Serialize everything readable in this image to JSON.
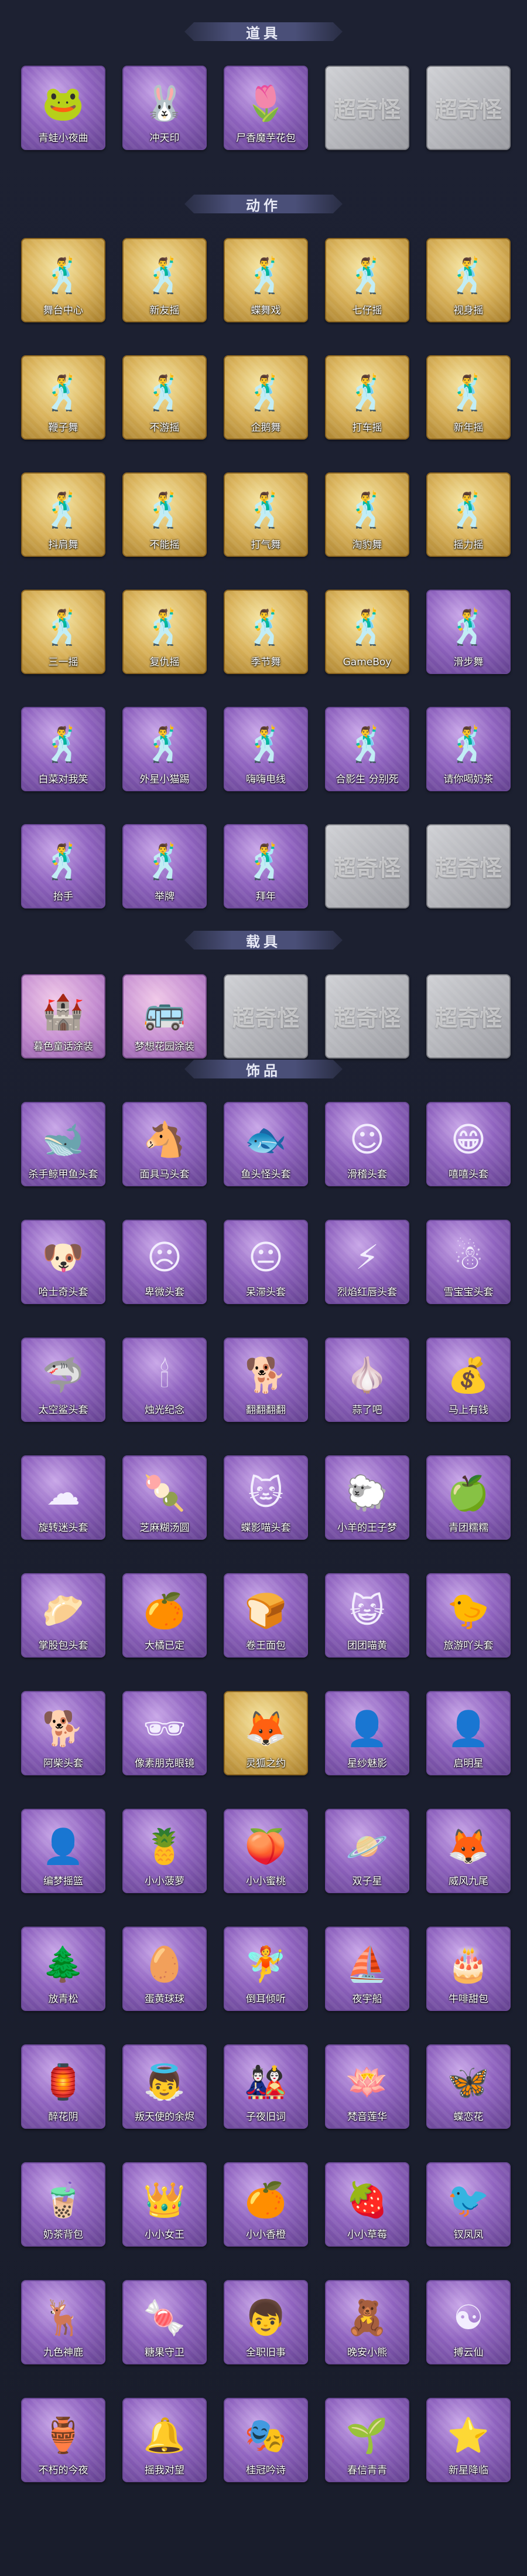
{
  "sections": [
    {
      "title": "道具",
      "items": [
        {
          "label": "青蛙小夜曲",
          "icon": "frog-icon",
          "style": "purple"
        },
        {
          "label": "冲天印",
          "icon": "bunny-mug-icon",
          "style": "purple"
        },
        {
          "label": "尸香魔芋花包",
          "icon": "flower-bag-icon",
          "style": "purple"
        },
        {
          "label": "",
          "icon": "mystery-icon",
          "style": "grey",
          "placeholder_text": "超奇怪"
        },
        {
          "label": "",
          "icon": "mystery-icon",
          "style": "grey",
          "placeholder_text": "超奇怪"
        }
      ]
    },
    {
      "title": "动作",
      "items": [
        {
          "label": "舞台中心",
          "icon": "pose-icon",
          "style": "gold"
        },
        {
          "label": "新友摇",
          "icon": "pose-icon",
          "style": "gold"
        },
        {
          "label": "蝶舞戏",
          "icon": "pose-icon",
          "style": "gold"
        },
        {
          "label": "七仔摇",
          "icon": "pose-icon",
          "style": "gold"
        },
        {
          "label": "视身摇",
          "icon": "pose-icon",
          "style": "gold"
        },
        {
          "label": "鞭子舞",
          "icon": "pose-icon",
          "style": "gold"
        },
        {
          "label": "不游摇",
          "icon": "pose-icon",
          "style": "gold"
        },
        {
          "label": "企鹅舞",
          "icon": "pose-icon",
          "style": "gold"
        },
        {
          "label": "打车摇",
          "icon": "pose-icon",
          "style": "gold"
        },
        {
          "label": "新年摇",
          "icon": "pose-icon",
          "style": "gold"
        },
        {
          "label": "抖肩舞",
          "icon": "pose-icon",
          "style": "gold"
        },
        {
          "label": "不能摇",
          "icon": "pose-icon",
          "style": "gold"
        },
        {
          "label": "打气舞",
          "icon": "pose-icon",
          "style": "gold"
        },
        {
          "label": "淘豹舞",
          "icon": "pose-icon",
          "style": "gold"
        },
        {
          "label": "摇力摇",
          "icon": "pose-icon",
          "style": "gold"
        },
        {
          "label": "三一摇",
          "icon": "pose-icon",
          "style": "gold"
        },
        {
          "label": "复仇摇",
          "icon": "pose-icon",
          "style": "gold"
        },
        {
          "label": "季节舞",
          "icon": "pose-icon",
          "style": "gold"
        },
        {
          "label": "GameBoy",
          "icon": "pose-icon",
          "style": "gold"
        },
        {
          "label": "滑步舞",
          "icon": "pose-icon",
          "style": "purple"
        },
        {
          "label": "白菜对我笑",
          "icon": "pose-icon",
          "style": "purple"
        },
        {
          "label": "外星小猫踢",
          "icon": "pose-icon",
          "style": "purple"
        },
        {
          "label": "嗨嗨电线",
          "icon": "pose-icon",
          "style": "purple"
        },
        {
          "label": "合影生 分别死",
          "icon": "pose-icon",
          "style": "purple"
        },
        {
          "label": "请你喝奶茶",
          "icon": "pose-icon",
          "style": "purple"
        },
        {
          "label": "抬手",
          "icon": "pose-icon",
          "style": "purple"
        },
        {
          "label": "举牌",
          "icon": "pose-icon",
          "style": "purple"
        },
        {
          "label": "拜年",
          "icon": "pose-icon",
          "style": "purple"
        },
        {
          "label": "",
          "icon": "mystery-icon",
          "style": "grey",
          "placeholder_text": "超奇怪"
        },
        {
          "label": "",
          "icon": "mystery-icon",
          "style": "grey",
          "placeholder_text": "超奇怪"
        }
      ]
    },
    {
      "title": "载具",
      "items": [
        {
          "label": "暮色童话涂装",
          "icon": "castle-icon",
          "style": "pink"
        },
        {
          "label": "梦想花园涂装",
          "icon": "bus-icon",
          "style": "pink"
        },
        {
          "label": "",
          "icon": "mystery-icon",
          "style": "grey",
          "placeholder_text": "超奇怪"
        },
        {
          "label": "",
          "icon": "mystery-icon",
          "style": "grey",
          "placeholder_text": "超奇怪"
        },
        {
          "label": "",
          "icon": "mystery-icon",
          "style": "grey",
          "placeholder_text": "超奇怪"
        }
      ]
    },
    {
      "title": "饰品",
      "items": [
        {
          "label": "杀手鲸甲鱼头套",
          "icon": "whale-head-icon",
          "style": "purple"
        },
        {
          "label": "面具马头套",
          "icon": "horse-head-icon",
          "style": "purple"
        },
        {
          "label": "鱼头怪头套",
          "icon": "fish-head-icon",
          "style": "purple"
        },
        {
          "label": "滑稽头套",
          "icon": "smiley-icon",
          "style": "purple"
        },
        {
          "label": "嘻嘻头套",
          "icon": "grin-icon",
          "style": "purple"
        },
        {
          "label": "哈士奇头套",
          "icon": "dog-head-icon",
          "style": "purple"
        },
        {
          "label": "卑微头套",
          "icon": "sad-face-icon",
          "style": "purple"
        },
        {
          "label": "呆滞头套",
          "icon": "blank-face-icon",
          "style": "purple"
        },
        {
          "label": "烈焰红唇头套",
          "icon": "pikachu-icon",
          "style": "purple"
        },
        {
          "label": "雪宝宝头套",
          "icon": "snowman-icon",
          "style": "purple"
        },
        {
          "label": "太空鲨头套",
          "icon": "shark-icon",
          "style": "purple"
        },
        {
          "label": "烛光纪念",
          "icon": "candle-icon",
          "style": "purple"
        },
        {
          "label": "翻翻翻翻",
          "icon": "puppy-icon",
          "style": "purple"
        },
        {
          "label": "蒜了吧",
          "icon": "garlic-icon",
          "style": "purple"
        },
        {
          "label": "马上有钱",
          "icon": "bag-icon",
          "style": "purple"
        },
        {
          "label": "旋转迷头套",
          "icon": "cloud-dog-icon",
          "style": "purple"
        },
        {
          "label": "芝麻糊汤圆",
          "icon": "dumpling-icon",
          "style": "purple"
        },
        {
          "label": "蝶影喵头套",
          "icon": "cat-head-icon",
          "style": "purple"
        },
        {
          "label": "小羊的王子梦",
          "icon": "sheep-icon",
          "style": "purple"
        },
        {
          "label": "青团糯糯",
          "icon": "green-bun-icon",
          "style": "purple"
        },
        {
          "label": "掌股包头套",
          "icon": "baozi-icon",
          "style": "purple"
        },
        {
          "label": "大橘已定",
          "icon": "orange-icon",
          "style": "purple"
        },
        {
          "label": "卷王面包",
          "icon": "bread-icon",
          "style": "purple"
        },
        {
          "label": "团团喵黄",
          "icon": "cat-face-icon",
          "style": "purple"
        },
        {
          "label": "旅游吖头套",
          "icon": "duck-icon",
          "style": "purple"
        },
        {
          "label": "阿柴头套",
          "icon": "shiba-icon",
          "style": "purple"
        },
        {
          "label": "像素朋克眼镜",
          "icon": "sunglasses-icon",
          "style": "purple"
        },
        {
          "label": "灵狐之约",
          "icon": "fox-icon",
          "style": "gold"
        },
        {
          "label": "星纱魅影",
          "icon": "figure-icon",
          "style": "purple"
        },
        {
          "label": "启明星",
          "icon": "figure-icon",
          "style": "purple"
        },
        {
          "label": "编梦摇篮",
          "icon": "figure-icon",
          "style": "purple"
        },
        {
          "label": "小小菠萝",
          "icon": "pineapple-icon",
          "style": "purple"
        },
        {
          "label": "小小蜜桃",
          "icon": "peach-icon",
          "style": "purple"
        },
        {
          "label": "双子星",
          "icon": "planet-icon",
          "style": "purple"
        },
        {
          "label": "威风九尾",
          "icon": "ninetail-icon",
          "style": "purple"
        },
        {
          "label": "放青松",
          "icon": "plant-icon",
          "style": "purple"
        },
        {
          "label": "蛋黄球球",
          "icon": "egg-icon",
          "style": "purple"
        },
        {
          "label": "倒耳倾听",
          "icon": "fairy-icon",
          "style": "purple"
        },
        {
          "label": "夜宇船",
          "icon": "ship-icon",
          "style": "purple"
        },
        {
          "label": "牛啡甜包",
          "icon": "cake-icon",
          "style": "purple"
        },
        {
          "label": "醉花阴",
          "icon": "lantern-icon",
          "style": "purple"
        },
        {
          "label": "叛天使的余烬",
          "icon": "angel-icon",
          "style": "purple"
        },
        {
          "label": "子夜旧词",
          "icon": "doll-icon",
          "style": "purple"
        },
        {
          "label": "梵音莲华",
          "icon": "lotus-icon",
          "style": "purple"
        },
        {
          "label": "蝶恋花",
          "icon": "butterfly-icon",
          "style": "purple"
        },
        {
          "label": "奶茶背包",
          "icon": "milktea-icon",
          "style": "purple"
        },
        {
          "label": "小小女王",
          "icon": "queen-icon",
          "style": "purple"
        },
        {
          "label": "小小香橙",
          "icon": "orange-doll-icon",
          "style": "purple"
        },
        {
          "label": "小小草莓",
          "icon": "strawberry-icon",
          "style": "purple"
        },
        {
          "label": "钗凤凤",
          "icon": "phoenix-icon",
          "style": "purple"
        },
        {
          "label": "九色神鹿",
          "icon": "deer-icon",
          "style": "purple"
        },
        {
          "label": "糖果守卫",
          "icon": "candy-icon",
          "style": "purple"
        },
        {
          "label": "全职旧事",
          "icon": "boy-icon",
          "style": "purple"
        },
        {
          "label": "晚安小熊",
          "icon": "bear-icon",
          "style": "purple"
        },
        {
          "label": "搏云仙",
          "icon": "immortal-icon",
          "style": "purple"
        },
        {
          "label": "不朽的今夜",
          "icon": "jar-icon",
          "style": "purple"
        },
        {
          "label": "摇我对望",
          "icon": "charm-icon",
          "style": "purple"
        },
        {
          "label": "桂冠吟诗",
          "icon": "poet-icon",
          "style": "purple"
        },
        {
          "label": "春信青青",
          "icon": "spring-icon",
          "style": "purple"
        },
        {
          "label": "新星降临",
          "icon": "star-doll-icon",
          "style": "purple"
        }
      ]
    }
  ],
  "icon_glyphs": {
    "frog-icon": "🐸",
    "bunny-mug-icon": "🐰",
    "flower-bag-icon": "🌷",
    "pose-icon": "🕺",
    "castle-icon": "🏰",
    "bus-icon": "🚌",
    "whale-head-icon": "🐋",
    "horse-head-icon": "🐴",
    "fish-head-icon": "🐟",
    "smiley-icon": "☺",
    "grin-icon": "😁",
    "dog-head-icon": "🐶",
    "sad-face-icon": "☹",
    "blank-face-icon": "😐",
    "pikachu-icon": "⚡",
    "snowman-icon": "☃",
    "shark-icon": "🦈",
    "candle-icon": "🕯",
    "puppy-icon": "🐕",
    "garlic-icon": "🧄",
    "bag-icon": "💰",
    "cloud-dog-icon": "☁",
    "dumpling-icon": "🍡",
    "cat-head-icon": "🐱",
    "sheep-icon": "🐑",
    "green-bun-icon": "🍏",
    "baozi-icon": "🥟",
    "orange-icon": "🍊",
    "bread-icon": "🍞",
    "cat-face-icon": "😺",
    "duck-icon": "🐤",
    "shiba-icon": "🐕",
    "sunglasses-icon": "🕶",
    "fox-icon": "🦊",
    "figure-icon": "👤",
    "pineapple-icon": "🍍",
    "peach-icon": "🍑",
    "planet-icon": "🪐",
    "ninetail-icon": "🦊",
    "plant-icon": "🌲",
    "egg-icon": "🥚",
    "fairy-icon": "🧚",
    "ship-icon": "⛵",
    "cake-icon": "🎂",
    "lantern-icon": "🏮",
    "angel-icon": "👼",
    "doll-icon": "🎎",
    "lotus-icon": "🪷",
    "butterfly-icon": "🦋",
    "milktea-icon": "🧋",
    "queen-icon": "👑",
    "orange-doll-icon": "🍊",
    "strawberry-icon": "🍓",
    "phoenix-icon": "🐦",
    "deer-icon": "🦌",
    "candy-icon": "🍬",
    "boy-icon": "👦",
    "bear-icon": "🧸",
    "immortal-icon": "☯",
    "jar-icon": "🏺",
    "charm-icon": "🔔",
    "poet-icon": "🎭",
    "spring-icon": "🌱",
    "star-doll-icon": "⭐",
    "mystery-icon": ""
  }
}
